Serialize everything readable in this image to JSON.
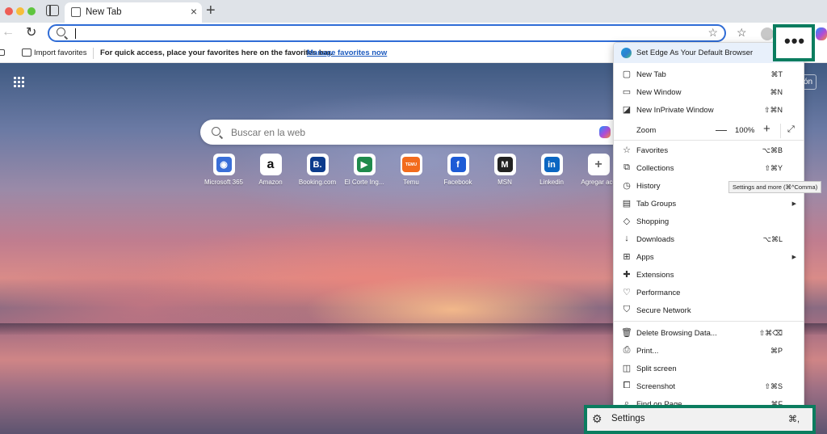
{
  "tab": {
    "title": "New Tab",
    "close": "×",
    "new": "+"
  },
  "toolbar": {
    "back": "←",
    "reload": "↻",
    "address_value": "",
    "star": "☆",
    "collections": "☆"
  },
  "favbar": {
    "import_label": "Import favorites",
    "hint": "For quick access, place your favorites here on the favorites bar.",
    "manage_link": "Manage favorites now"
  },
  "content": {
    "signin_partial": "ón",
    "search_placeholder": "Buscar en la web",
    "quick_links": [
      {
        "label": "Microsoft 365",
        "glyph": "◉",
        "color": "#3a6fd8"
      },
      {
        "label": "Amazon",
        "glyph": "a",
        "color": "#111111"
      },
      {
        "label": "Booking.com",
        "glyph": "B.",
        "color": "#0c3b8c"
      },
      {
        "label": "El Corte Ing...",
        "glyph": "▶",
        "color": "#1f8a4c"
      },
      {
        "label": "Temu",
        "glyph": "TEMU",
        "color": "#f26b1d"
      },
      {
        "label": "Facebook",
        "glyph": "f",
        "color": "#1d5bd6"
      },
      {
        "label": "MSN",
        "glyph": "M",
        "color": "#222222"
      },
      {
        "label": "Linkedin",
        "glyph": "in",
        "color": "#0b66c2"
      },
      {
        "label": "Agregar acc",
        "glyph": "+",
        "color": "#666666"
      }
    ]
  },
  "menu": {
    "default_browser": "Set Edge As Your Default Browser",
    "items": [
      {
        "id": "new-tab",
        "icon": "▢",
        "label": "New Tab",
        "shortcut": "⌘T"
      },
      {
        "id": "new-window",
        "icon": "▭",
        "label": "New Window",
        "shortcut": "⌘N"
      },
      {
        "id": "new-inprivate",
        "icon": "◪",
        "label": "New InPrivate Window",
        "shortcut": "⇧⌘N"
      },
      {
        "id": "favorites",
        "icon": "☆",
        "label": "Favorites",
        "shortcut": "⌥⌘B"
      },
      {
        "id": "collections",
        "icon": "⧉",
        "label": "Collections",
        "shortcut": "⇧⌘Y"
      },
      {
        "id": "history",
        "icon": "◷",
        "label": "History",
        "shortcut": ""
      },
      {
        "id": "tab-groups",
        "icon": "▤",
        "label": "Tab Groups",
        "shortcut": ""
      },
      {
        "id": "shopping",
        "icon": "◇",
        "label": "Shopping",
        "shortcut": ""
      },
      {
        "id": "downloads",
        "icon": "↓",
        "label": "Downloads",
        "shortcut": "⌥⌘L"
      },
      {
        "id": "apps",
        "icon": "⊞",
        "label": "Apps",
        "shortcut": ""
      },
      {
        "id": "extensions",
        "icon": "✚",
        "label": "Extensions",
        "shortcut": ""
      },
      {
        "id": "performance",
        "icon": "♡",
        "label": "Performance",
        "shortcut": ""
      },
      {
        "id": "secure-network",
        "icon": "⛉",
        "label": "Secure Network",
        "shortcut": ""
      },
      {
        "id": "delete-browsing-data",
        "icon": "🗑",
        "label": "Delete Browsing Data...",
        "shortcut": "⇧⌘⌫"
      },
      {
        "id": "print",
        "icon": "⎙",
        "label": "Print...",
        "shortcut": "⌘P"
      },
      {
        "id": "split-screen",
        "icon": "◫",
        "label": "Split screen",
        "shortcut": ""
      },
      {
        "id": "screenshot",
        "icon": "⧠",
        "label": "Screenshot",
        "shortcut": "⇧⌘S"
      },
      {
        "id": "find-on-page",
        "icon": "⌕",
        "label": "Find on Page...",
        "shortcut": "⌘F"
      }
    ],
    "zoom": {
      "label": "Zoom",
      "minus": "—",
      "value": "100%",
      "plus": "+",
      "fullscreen": "⤢"
    },
    "submenu_arrow": "▶",
    "settings": {
      "icon": "⚙",
      "label": "Settings",
      "shortcut": "⌘,"
    }
  },
  "tooltip": "Settings and more (⌘^Comma)",
  "more_button": "•••"
}
